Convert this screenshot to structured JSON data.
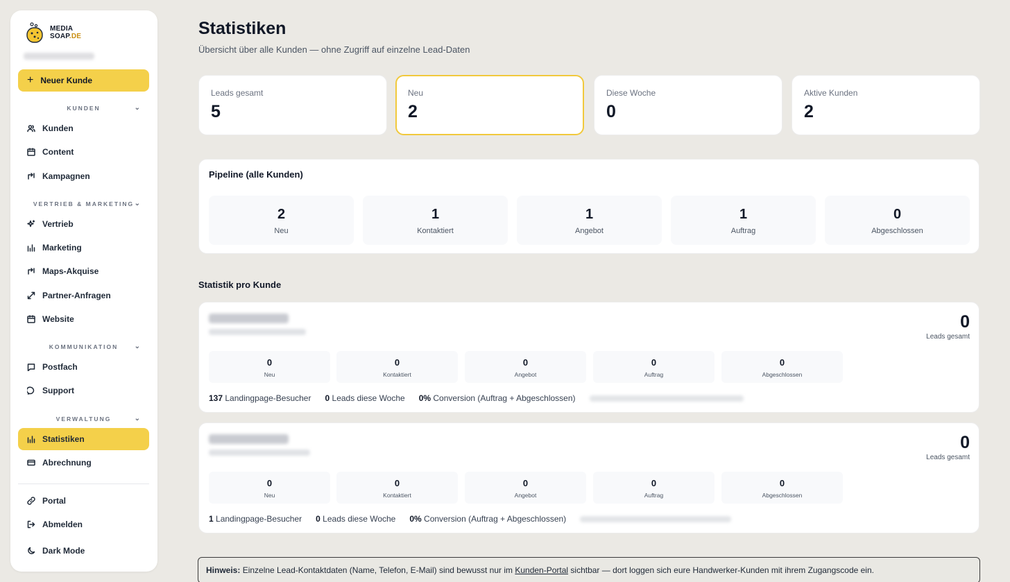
{
  "brand": {
    "line1": "MEDIA",
    "line2": "SOAP",
    "tld": ".DE"
  },
  "sidebar": {
    "new_button": "Neuer Kunde",
    "sections": [
      {
        "title": "KUNDEN",
        "items": [
          "Kunden",
          "Content",
          "Kampagnen"
        ]
      },
      {
        "title": "VERTRIEB & MARKETING",
        "items": [
          "Vertrieb",
          "Marketing",
          "Maps-Akquise",
          "Partner-Anfragen",
          "Website"
        ]
      },
      {
        "title": "KOMMUNIKATION",
        "items": [
          "Postfach",
          "Support"
        ]
      },
      {
        "title": "VERWALTUNG",
        "items": [
          "Statistiken",
          "Abrechnung"
        ]
      }
    ],
    "footer": [
      "Portal",
      "Abmelden",
      "Dark Mode"
    ],
    "active": "Statistiken"
  },
  "header": {
    "title": "Statistiken",
    "subtitle": "Übersicht über alle Kunden — ohne Zugriff auf einzelne Lead-Daten"
  },
  "kpis": [
    {
      "label": "Leads gesamt",
      "value": "5"
    },
    {
      "label": "Neu",
      "value": "2"
    },
    {
      "label": "Diese Woche",
      "value": "0"
    },
    {
      "label": "Aktive Kunden",
      "value": "2"
    }
  ],
  "pipeline": {
    "title": "Pipeline (alle Kunden)",
    "stages": [
      {
        "value": "2",
        "label": "Neu"
      },
      {
        "value": "1",
        "label": "Kontaktiert"
      },
      {
        "value": "1",
        "label": "Angebot"
      },
      {
        "value": "1",
        "label": "Auftrag"
      },
      {
        "value": "0",
        "label": "Abgeschlossen"
      }
    ]
  },
  "per_customer": {
    "title": "Statistik pro Kunde",
    "total_label": "Leads gesamt",
    "stage_labels": [
      "Neu",
      "Kontaktiert",
      "Angebot",
      "Auftrag",
      "Abgeschlossen"
    ],
    "visitors_label": "Landingpage-Besucher",
    "week_label": "Leads diese Woche",
    "conversion_label": "Conversion (Auftrag + Abgeschlossen)",
    "customers": [
      {
        "total": "0",
        "stages": [
          "0",
          "0",
          "0",
          "0",
          "0"
        ],
        "visitors": "137",
        "week": "0",
        "conversion": "0%"
      },
      {
        "total": "0",
        "stages": [
          "0",
          "0",
          "0",
          "0",
          "0"
        ],
        "visitors": "1",
        "week": "0",
        "conversion": "0%"
      }
    ]
  },
  "hint": {
    "label": "Hinweis:",
    "text_before": "Einzelne Lead-Kontaktdaten (Name, Telefon, E-Mail) sind bewusst nur im",
    "link": "Kunden-Portal",
    "text_after": "sichtbar — dort loggen sich eure Handwerker-Kunden mit ihrem Zugangscode ein."
  },
  "colors": {
    "accent": "#f4d04a",
    "background": "#ebe9e4",
    "card": "#ffffff",
    "highlight_border": "#f1c93c"
  }
}
